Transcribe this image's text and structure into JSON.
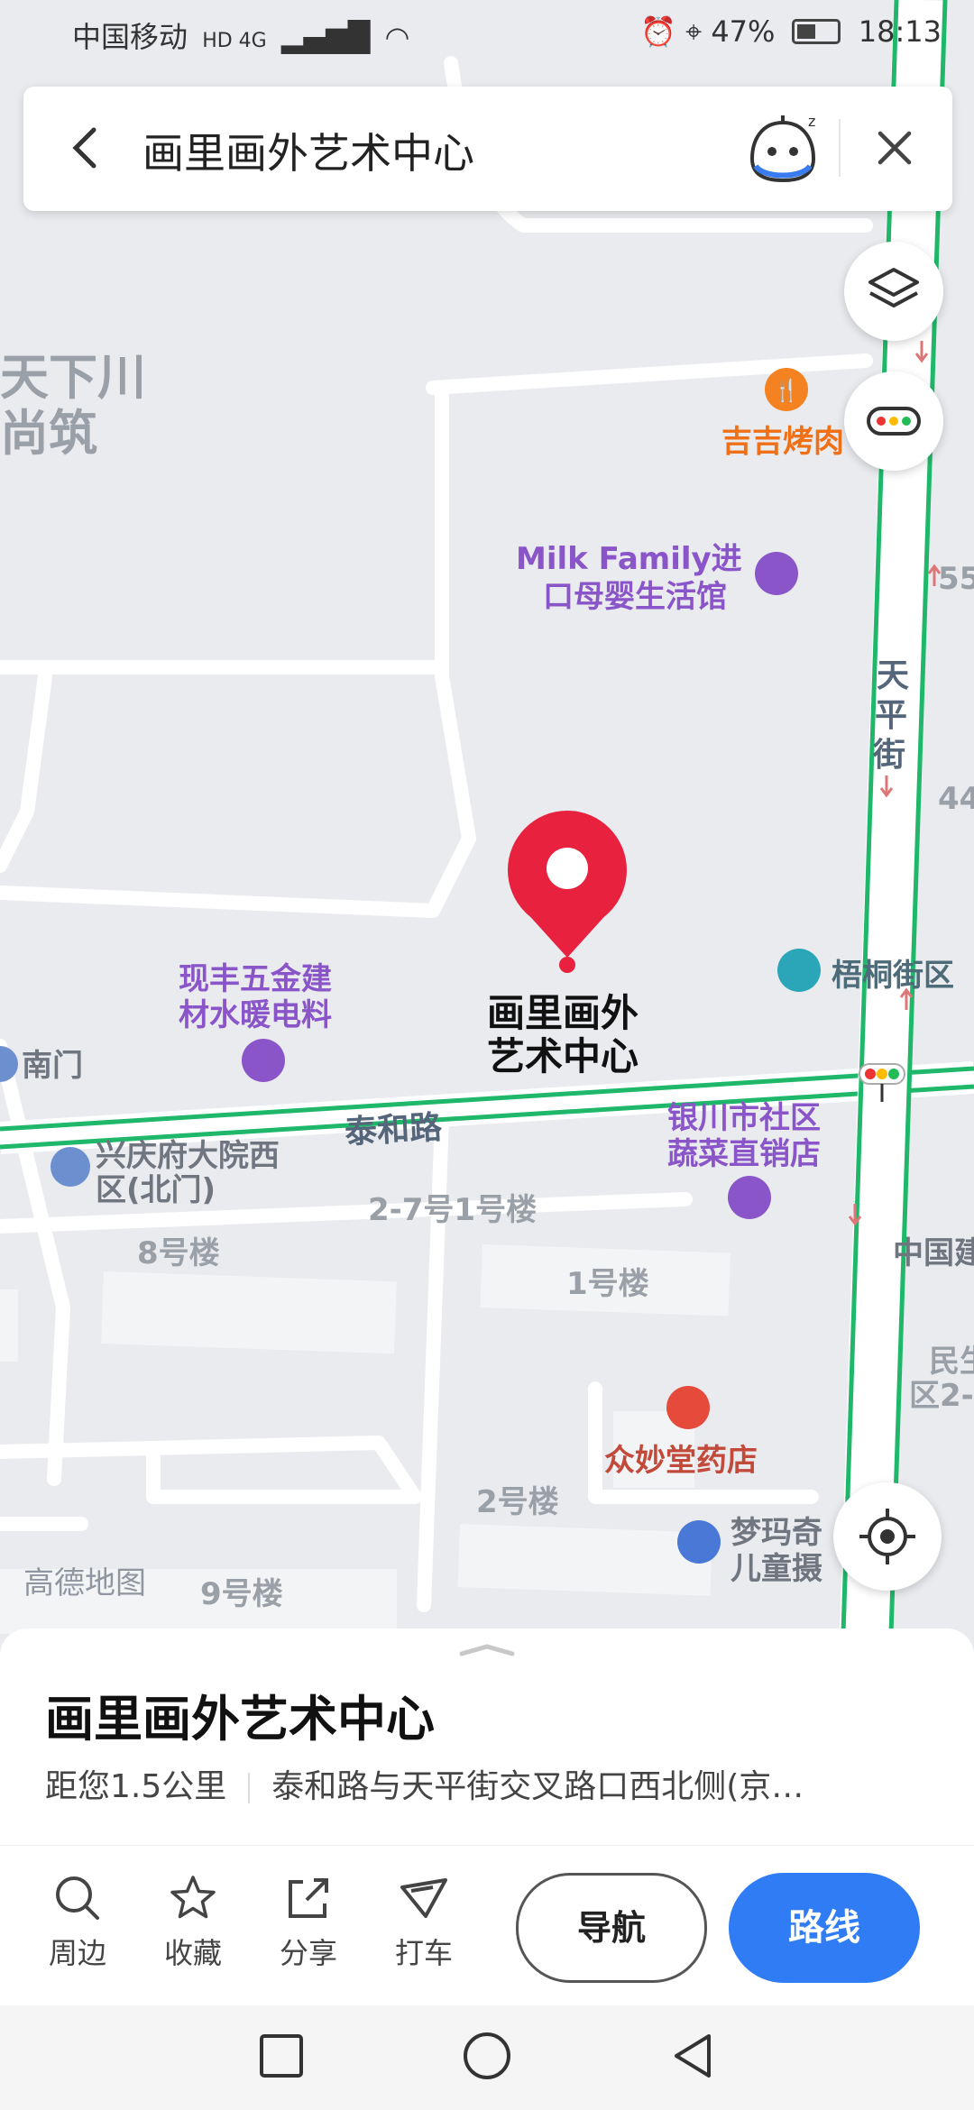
{
  "status": {
    "carrier": "中国移动",
    "network": "HD 4G",
    "battery": "47%",
    "time": "18:13"
  },
  "search": {
    "title": "画里画外艺术中心"
  },
  "map": {
    "pois": {
      "tianxia": "天下川",
      "shangzhu": "尚筑",
      "jiji": "吉吉烤肉",
      "milk1": "Milk Family进",
      "milk2": "口母婴生活馆",
      "wutong": "梧桐街区",
      "xianfeng1": "现丰五金建",
      "xianfeng2": "材水暖电料",
      "nanmen": "南门",
      "xingqing1": "兴庆府大院西",
      "xingqing2": "区(北门)",
      "yinchuan1": "银川市社区",
      "yinchuan2": "蔬菜直销店",
      "bldg27": "2-7号1号楼",
      "bldg8": "8号楼",
      "bldg1": "1号楼",
      "zhongmiao": "众妙堂药店",
      "bldg2": "2号楼",
      "mengma1": "梦玛奇",
      "mengma2": "儿童摄",
      "bldg9": "9号楼",
      "zhongguojian": "中国建",
      "minsheng1": "民生",
      "minsheng2": "区2-",
      "num55": "55",
      "num44": "44"
    },
    "roads": {
      "taihe": "泰和路",
      "tianping1": "天",
      "tianping2": "平",
      "tianping3": "街"
    },
    "marker_label_1": "画里画外",
    "marker_label_2": "艺术中心",
    "watermark": "高德地图"
  },
  "place": {
    "name": "画里画外艺术中心",
    "distance": "距您1.5公里",
    "address": "泰和路与天平街交叉路口西北侧(京…"
  },
  "toolbar": {
    "nearby": "周边",
    "favorite": "收藏",
    "share": "分享",
    "taxi": "打车",
    "navigate": "导航",
    "route": "路线"
  }
}
